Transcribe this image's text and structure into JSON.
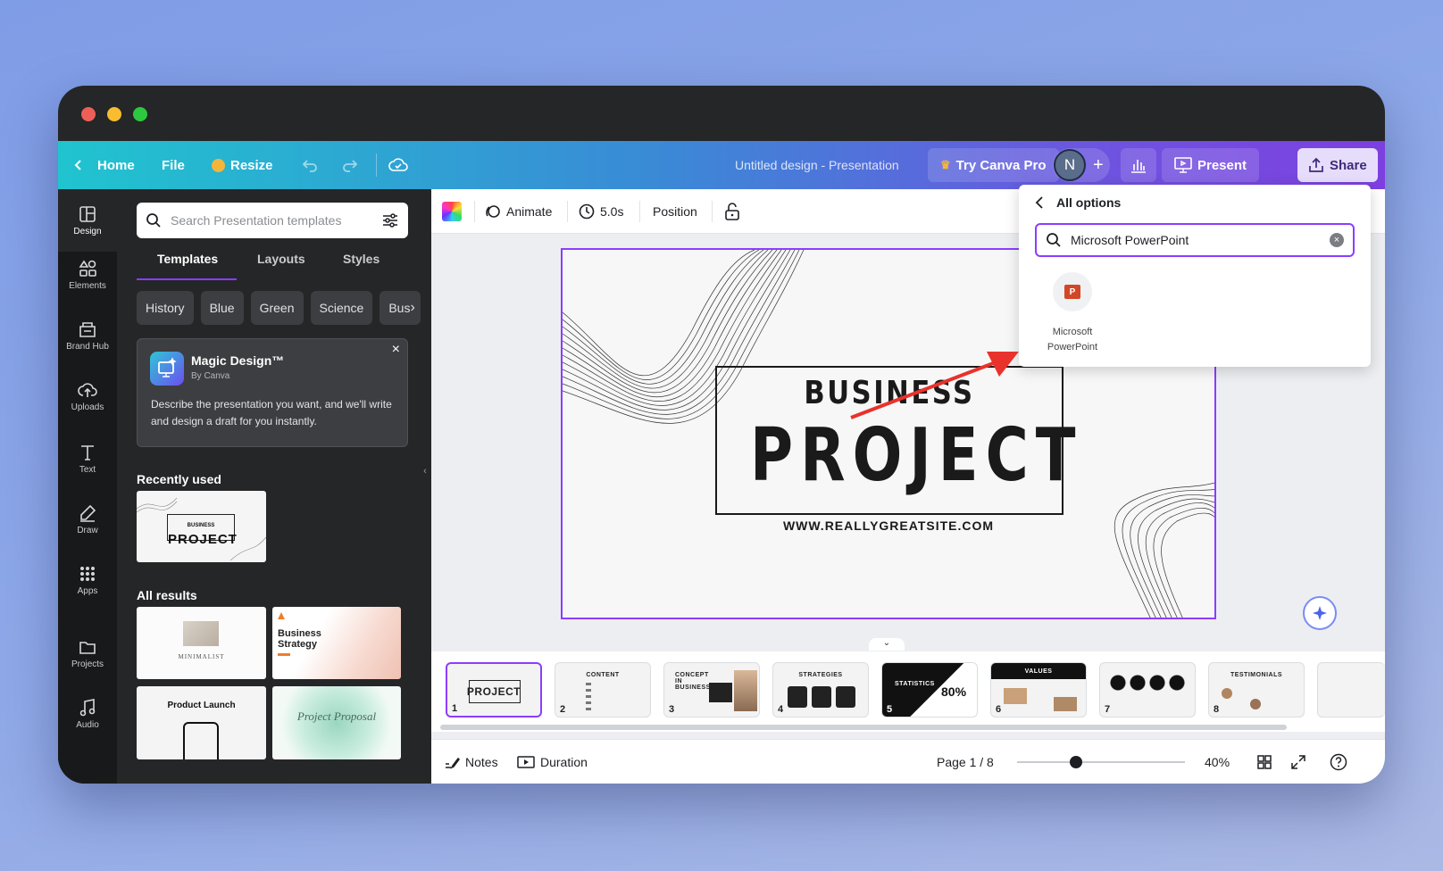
{
  "topbar": {
    "home_label": "Home",
    "file_label": "File",
    "resize_label": "Resize",
    "doc_title": "Untitled design - Presentation",
    "try_pro_label": "Try Canva Pro",
    "avatar_initial": "N",
    "present_label": "Present",
    "share_label": "Share"
  },
  "rail": {
    "items": [
      "Design",
      "Elements",
      "Brand Hub",
      "Uploads",
      "Text",
      "Draw",
      "Apps",
      "Projects",
      "Audio"
    ]
  },
  "panel": {
    "search_placeholder": "Search Presentation templates",
    "tabs": [
      "Templates",
      "Layouts",
      "Styles"
    ],
    "chips": [
      "History",
      "Blue",
      "Green",
      "Science",
      "Bus"
    ],
    "magic": {
      "title": "Magic Design™",
      "byline": "By Canva",
      "description": "Describe the presentation you want, and we'll write and design a draft for you instantly."
    },
    "recently_used_label": "Recently used",
    "recent_thumb": {
      "line1": "BUSINESS",
      "line2": "PROJECT"
    },
    "all_results_label": "All results",
    "results": [
      {
        "title": "MINIMALIST"
      },
      {
        "title": "Business Strategy"
      },
      {
        "title": "Product Launch"
      },
      {
        "title": "Project Proposal"
      }
    ]
  },
  "canvas_toolbar": {
    "animate_label": "Animate",
    "duration_value": "5.0s",
    "position_label": "Position"
  },
  "slide": {
    "line1": "BUSINESS",
    "line2": "PROJECT",
    "url": "WWW.REALLYGREATSITE.COM"
  },
  "filmstrip": [
    {
      "num": "1",
      "title": "PROJECT"
    },
    {
      "num": "2",
      "title": "CONTENT"
    },
    {
      "num": "3",
      "title": "CONCEPT IN BUSINESS"
    },
    {
      "num": "4",
      "title": "STRATEGIES"
    },
    {
      "num": "5",
      "title": "STATISTICS",
      "stat": "80%"
    },
    {
      "num": "6",
      "title": "VALUES"
    },
    {
      "num": "7",
      "title": ""
    },
    {
      "num": "8",
      "title": "TESTIMONIALS"
    }
  ],
  "bottombar": {
    "notes_label": "Notes",
    "duration_label": "Duration",
    "page_label": "Page 1 / 8",
    "zoom_label": "40%",
    "zoom_value": 0.4
  },
  "share_dropdown": {
    "back_label": "All options",
    "search_value": "Microsoft PowerPoint",
    "result_line1": "Microsoft",
    "result_line2": "PowerPoint"
  },
  "colors": {
    "accent_purple": "#8b3dff",
    "arrow_red": "#e8322b",
    "pro_crown": "#f5b53b"
  }
}
